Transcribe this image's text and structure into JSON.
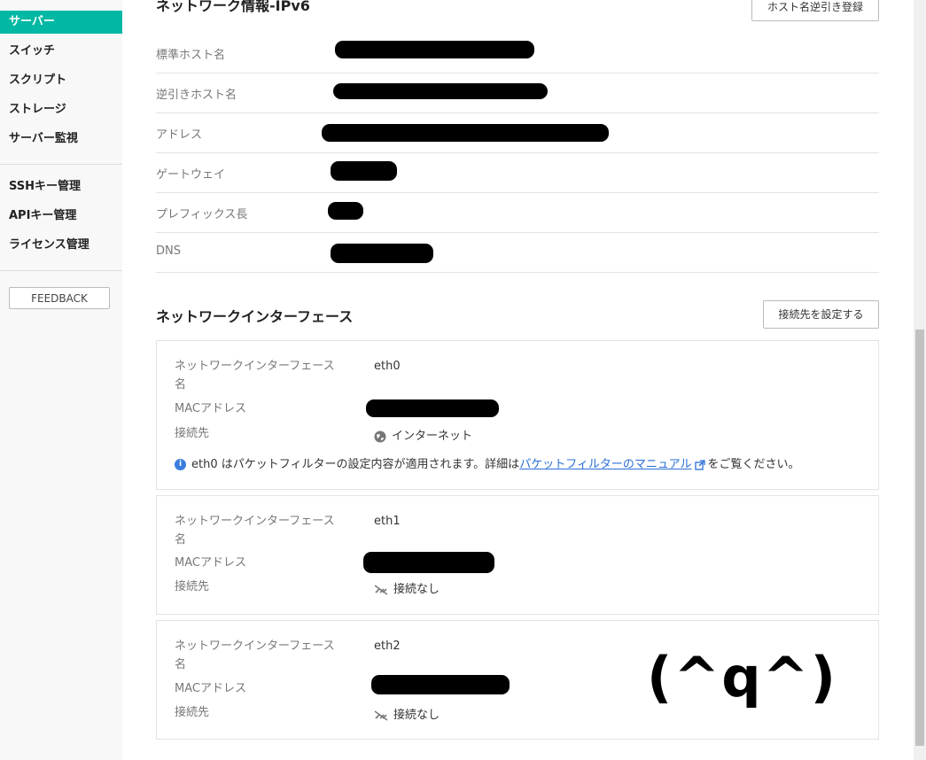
{
  "sidebar": {
    "items": [
      {
        "label": "サーバー",
        "active": true
      },
      {
        "label": "スイッチ"
      },
      {
        "label": "スクリプト"
      },
      {
        "label": "ストレージ"
      },
      {
        "label": "サーバー監視"
      },
      {
        "label": "SSHキー管理"
      },
      {
        "label": "APIキー管理"
      },
      {
        "label": "ライセンス管理"
      }
    ],
    "feedback_label": "FEEDBACK"
  },
  "ipv6": {
    "title": "ネットワーク情報-IPv6",
    "register_button": "ホスト名逆引き登録",
    "rows": [
      {
        "label": "標準ホスト名"
      },
      {
        "label": "逆引きホスト名"
      },
      {
        "label": "アドレス"
      },
      {
        "label": "ゲートウェイ"
      },
      {
        "label": "プレフィックス長"
      },
      {
        "label": "DNS"
      }
    ]
  },
  "interfaces": {
    "title": "ネットワークインターフェース",
    "connect_button": "接続先を設定する",
    "labels": {
      "name": "ネットワークインターフェース名",
      "mac": "MACアドレス",
      "connection": "接続先"
    },
    "cards": [
      {
        "name": "eth0",
        "connection": "インターネット",
        "icon": "globe-icon"
      },
      {
        "name": "eth1",
        "connection": "接続なし",
        "icon": "unlink-icon"
      },
      {
        "name": "eth2",
        "connection": "接続なし",
        "icon": "unlink-icon"
      }
    ],
    "info": {
      "prefix": "eth0 はパケットフィルターの設定内容が適用されます。詳細は",
      "link": "パケットフィルターのマニュアル",
      "suffix": "をご覧ください。"
    }
  },
  "doodle": "(^q^)",
  "colors": {
    "accent": "#00b8a3",
    "link": "#2a6fd6",
    "info": "#3b7ddd"
  }
}
